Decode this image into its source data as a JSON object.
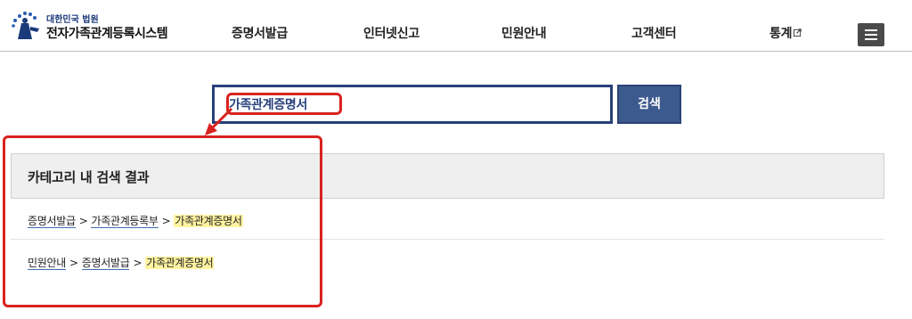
{
  "header": {
    "logo_sub": "대한민국 법원",
    "logo_title": "전자가족관계등록시스템",
    "nav": [
      {
        "label": "증명서발급"
      },
      {
        "label": "인터넷신고"
      },
      {
        "label": "민원안내"
      },
      {
        "label": "고객센터"
      },
      {
        "label": "통계"
      }
    ],
    "menu_icon": "hamburger-icon",
    "external_icon": "external-link-icon"
  },
  "search": {
    "value": "가족관계증명서",
    "button_label": "검색"
  },
  "results": {
    "title": "카테고리 내 검색 결과",
    "rows": [
      {
        "path": [
          "증명서발급",
          "가족관계등록부"
        ],
        "current": "가족관계증명서",
        "separator": ">"
      },
      {
        "path": [
          "민원안내",
          "증명서발급"
        ],
        "current": "가족관계증명서",
        "separator": ">"
      }
    ]
  },
  "colors": {
    "annotation": "#d9221f",
    "search_border": "#273f7a",
    "search_button": "#3d5a8f",
    "highlight": "#fff3a0"
  }
}
